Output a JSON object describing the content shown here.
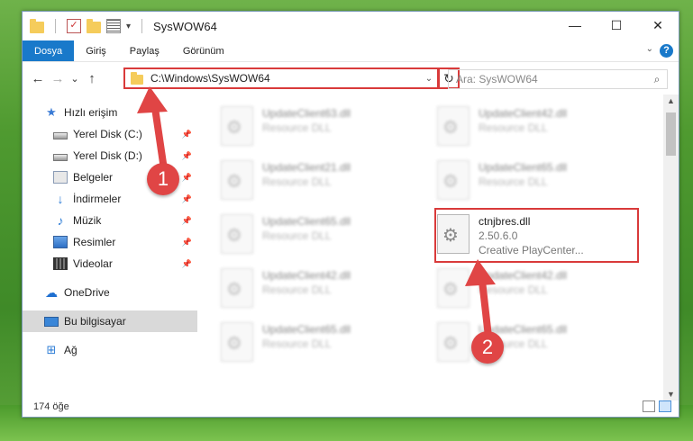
{
  "window": {
    "title": "SysWOW64",
    "controls": {
      "minimize": "—",
      "maximize": "☐",
      "close": "✕"
    }
  },
  "ribbon": {
    "tabs": [
      "Dosya",
      "Giriş",
      "Paylaş",
      "Görünüm"
    ],
    "help_icon": "?"
  },
  "navigation": {
    "back": "←",
    "forward": "→",
    "recent": "⌄",
    "up": "↑",
    "path": "C:\\Windows\\SysWOW64",
    "refresh": "↻"
  },
  "search": {
    "placeholder": "Ara: SysWOW64",
    "icon": "⌕"
  },
  "sidebar": {
    "items": [
      {
        "label": "Hızlı erişim",
        "icon": "star-icon"
      },
      {
        "label": "Yerel Disk (C:)",
        "icon": "drive-icon",
        "pinned": true
      },
      {
        "label": "Yerel Disk (D:)",
        "icon": "drive-icon",
        "pinned": true
      },
      {
        "label": "Belgeler",
        "icon": "documents-icon",
        "pinned": true
      },
      {
        "label": "İndirmeler",
        "icon": "download-icon",
        "pinned": true
      },
      {
        "label": "Müzik",
        "icon": "music-icon",
        "pinned": true
      },
      {
        "label": "Resimler",
        "icon": "pictures-icon",
        "pinned": true
      },
      {
        "label": "Videolar",
        "icon": "videos-icon",
        "pinned": true
      },
      {
        "label": "OneDrive",
        "icon": "cloud-icon"
      },
      {
        "label": "Bu bilgisayar",
        "icon": "computer-icon",
        "selected": true
      },
      {
        "label": "Ağ",
        "icon": "network-icon"
      }
    ]
  },
  "files": [
    {
      "name": "UpdateClient63.dll",
      "desc": "Resource DLL"
    },
    {
      "name": "UpdateClient42.dll",
      "desc": "Resource DLL"
    },
    {
      "name": "UpdateClient21.dll",
      "desc": "Resource DLL"
    },
    {
      "name": "UpdateClient65.dll",
      "desc": "Resource DLL"
    },
    {
      "name": "UpdateClient65.dll",
      "desc": "Resource DLL"
    },
    {
      "name": "ctnjbres.dll",
      "version": "2.50.6.0",
      "desc": "Creative PlayCenter..."
    },
    {
      "name": "UpdateClient42.dll",
      "desc": "Resource DLL"
    },
    {
      "name": "UpdateClient42.dll",
      "desc": "Resource DLL"
    },
    {
      "name": "UpdateClient65.dll",
      "desc": "Resource DLL"
    },
    {
      "name": "UpdateClient65.dll",
      "desc": "Resource DLL"
    }
  ],
  "status": {
    "item_count": "174 öğe"
  },
  "callouts": {
    "step1": "1",
    "step2": "2"
  },
  "colors": {
    "accent": "#1979ca",
    "highlight": "#d93a3a"
  }
}
